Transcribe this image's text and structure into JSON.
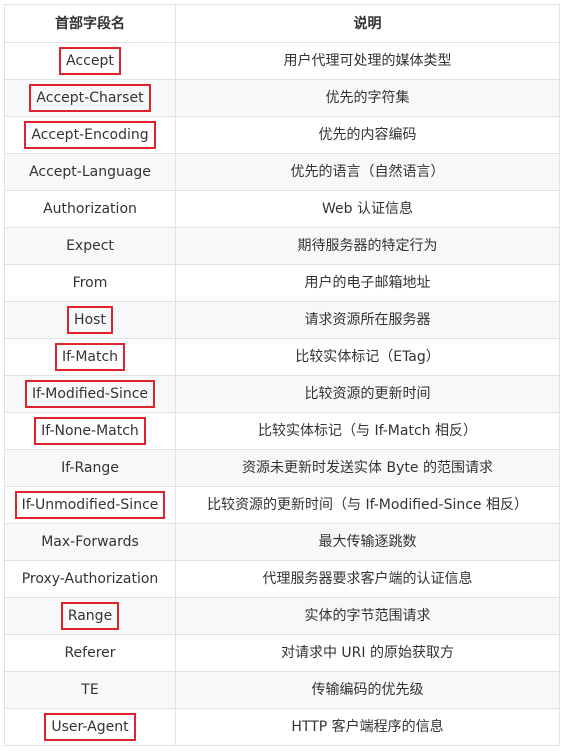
{
  "table": {
    "headers": {
      "field": "首部字段名",
      "desc": "说明"
    },
    "highlight_color": "#e0242e",
    "rows": [
      {
        "name": "Accept",
        "desc": "用户代理可处理的媒体类型",
        "highlighted": true
      },
      {
        "name": "Accept-Charset",
        "desc": "优先的字符集",
        "highlighted": true
      },
      {
        "name": "Accept-Encoding",
        "desc": "优先的内容编码",
        "highlighted": true
      },
      {
        "name": "Accept-Language",
        "desc": "优先的语言（自然语言）",
        "highlighted": false
      },
      {
        "name": "Authorization",
        "desc": "Web 认证信息",
        "highlighted": false
      },
      {
        "name": "Expect",
        "desc": "期待服务器的特定行为",
        "highlighted": false
      },
      {
        "name": "From",
        "desc": "用户的电子邮箱地址",
        "highlighted": false
      },
      {
        "name": "Host",
        "desc": "请求资源所在服务器",
        "highlighted": true
      },
      {
        "name": "If-Match",
        "desc": "比较实体标记（ETag）",
        "highlighted": true
      },
      {
        "name": "If-Modified-Since",
        "desc": "比较资源的更新时间",
        "highlighted": true
      },
      {
        "name": "If-None-Match",
        "desc": "比较实体标记（与 If-Match 相反）",
        "highlighted": true
      },
      {
        "name": "If-Range",
        "desc": "资源未更新时发送实体 Byte 的范围请求",
        "highlighted": false
      },
      {
        "name": "If-Unmodified-Since",
        "desc": "比较资源的更新时间（与 If-Modified-Since 相反）",
        "highlighted": true
      },
      {
        "name": "Max-Forwards",
        "desc": "最大传输逐跳数",
        "highlighted": false
      },
      {
        "name": "Proxy-Authorization",
        "desc": "代理服务器要求客户端的认证信息",
        "highlighted": false
      },
      {
        "name": "Range",
        "desc": "实体的字节范围请求",
        "highlighted": true
      },
      {
        "name": "Referer",
        "desc": "对请求中 URI 的原始获取方",
        "highlighted": false
      },
      {
        "name": "TE",
        "desc": "传输编码的优先级",
        "highlighted": false
      },
      {
        "name": "User-Agent",
        "desc": "HTTP 客户端程序的信息",
        "highlighted": true
      }
    ]
  }
}
